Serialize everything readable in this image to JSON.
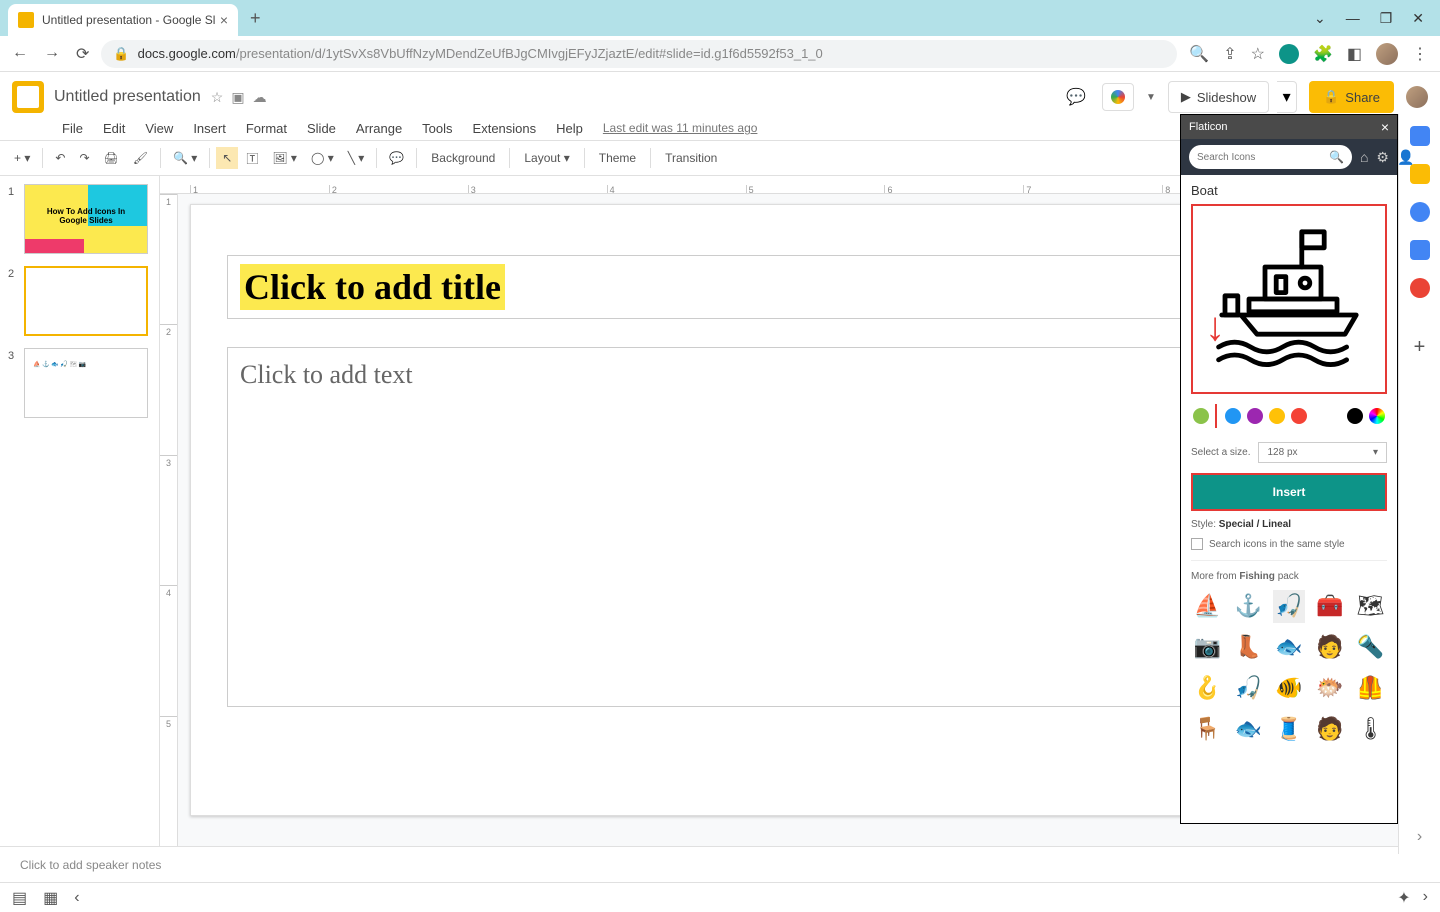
{
  "browser": {
    "tab_title": "Untitled presentation - Google Sl",
    "url_domain": "docs.google.com",
    "url_path": "/presentation/d/1ytSvXs8VbUffNzyMDendZeUfBJgCMIvgjEFyJZjaztE/edit#slide=id.g1f6d5592f53_1_0"
  },
  "header": {
    "doc_title": "Untitled presentation",
    "last_edit": "Last edit was 11 minutes ago",
    "slideshow": "Slideshow",
    "share": "Share"
  },
  "menu": {
    "items": [
      "File",
      "Edit",
      "View",
      "Insert",
      "Format",
      "Slide",
      "Arrange",
      "Tools",
      "Extensions",
      "Help"
    ]
  },
  "toolbar": {
    "background": "Background",
    "layout": "Layout",
    "theme": "Theme",
    "transition": "Transition"
  },
  "slides": {
    "thumb1_text": "How To Add Icons In Google Slides",
    "title_placeholder": "Click to add title",
    "body_placeholder": "Click to add text"
  },
  "speaker_notes": "Click to add speaker notes",
  "flaticon": {
    "panel_title": "Flaticon",
    "search_placeholder": "Search Icons",
    "icon_name": "Boat",
    "size_label": "Select a size.",
    "size_value": "128 px",
    "insert": "Insert",
    "style_label": "Style:",
    "style_value": "Special / Lineal",
    "same_style_label": "Search icons in the same style",
    "more_from": "More from",
    "pack_name": "Fishing",
    "pack_suffix": "pack",
    "colors": [
      "#8bc34a",
      "#2196f3",
      "#9c27b0",
      "#ffc107",
      "#f44336",
      "#000000",
      "conic-gradient(red,yellow,lime,cyan,blue,magenta,red)"
    ]
  }
}
